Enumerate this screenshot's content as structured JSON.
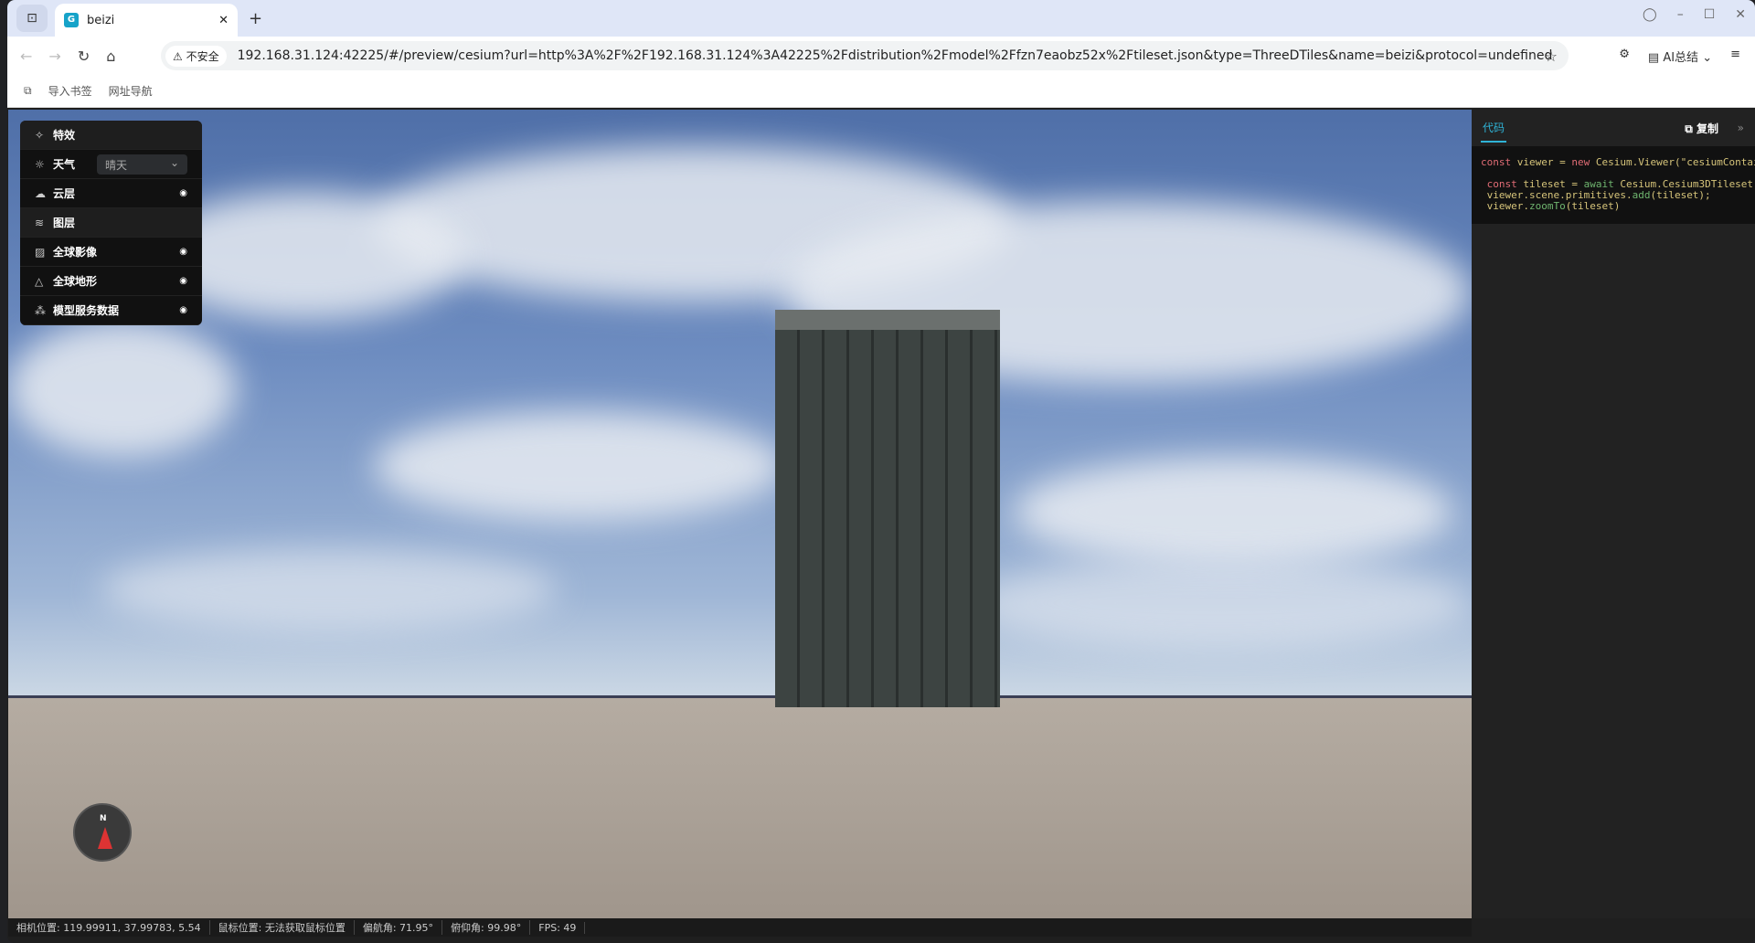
{
  "browser": {
    "tab_title": "beizi",
    "favicon": "G",
    "insecure_label": "不安全",
    "url": "192.168.31.124:42225/#/preview/cesium?url=http%3A%2F%2F192.168.31.124%3A42225%2Fdistribution%2Fmodel%2Ffzn7eaobz52x%2Ftileset.json&type=ThreeDTiles&name=beizi&protocol=undefined",
    "ai_label": "AI总结",
    "bookmarks": [
      "导入书签",
      "网址导航"
    ]
  },
  "panel": {
    "effects": "特效",
    "weather": "天气",
    "weather_value": "晴天",
    "clouds": "云层",
    "layers": "图层",
    "imagery": "全球影像",
    "terrain": "全球地形",
    "model": "模型服务数据"
  },
  "compass": {
    "north": "N"
  },
  "status": {
    "camera": "相机位置: 119.99911, 37.99783, 5.54",
    "mouse": "鼠标位置: 无法获取鼠标位置",
    "heading": "偏航角: 71.95°",
    "pitch": "俯仰角: 99.98°",
    "fps": "FPS: 49"
  },
  "code": {
    "tab": "代码",
    "copy": "复制"
  }
}
